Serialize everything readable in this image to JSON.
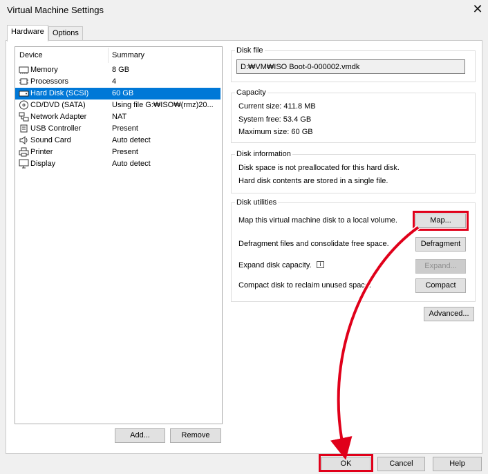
{
  "window": {
    "title": "Virtual Machine Settings",
    "close_glyph": "✕"
  },
  "tabs": [
    {
      "label": "Hardware",
      "active": true
    },
    {
      "label": "Options",
      "active": false
    }
  ],
  "device_list": {
    "col_device": "Device",
    "col_summary": "Summary",
    "rows": [
      {
        "device": "Memory",
        "summary": "8 GB",
        "icon": "memory-icon"
      },
      {
        "device": "Processors",
        "summary": "4",
        "icon": "processor-icon"
      },
      {
        "device": "Hard Disk (SCSI)",
        "summary": "60 GB",
        "icon": "hard-disk-icon",
        "selected": true
      },
      {
        "device": "CD/DVD (SATA)",
        "summary": "Using file G:₩ISO₩(rmz)20...",
        "icon": "cd-dvd-icon"
      },
      {
        "device": "Network Adapter",
        "summary": "NAT",
        "icon": "network-adapter-icon"
      },
      {
        "device": "USB Controller",
        "summary": "Present",
        "icon": "usb-controller-icon"
      },
      {
        "device": "Sound Card",
        "summary": "Auto detect",
        "icon": "sound-card-icon"
      },
      {
        "device": "Printer",
        "summary": "Present",
        "icon": "printer-icon"
      },
      {
        "device": "Display",
        "summary": "Auto detect",
        "icon": "display-icon"
      }
    ],
    "add_label": "Add...",
    "remove_label": "Remove"
  },
  "disk_file": {
    "label": "Disk file",
    "value": "D:₩VM₩ISO Boot-0-000002.vmdk"
  },
  "capacity": {
    "label": "Capacity",
    "current_size": "Current size:  411.8 MB",
    "system_free": "System free:  53.4 GB",
    "maximum_size": "Maximum size:  60 GB"
  },
  "disk_information": {
    "label": "Disk information",
    "line1": "Disk space is not preallocated for this hard disk.",
    "line2": "Hard disk contents are stored in a single file."
  },
  "disk_utilities": {
    "label": "Disk utilities",
    "map_text": "Map this virtual machine disk to a local volume.",
    "map_button": "Map...",
    "defrag_text": "Defragment files and consolidate free space.",
    "defrag_button": "Defragment",
    "expand_text": "Expand disk capacity.",
    "expand_button": "Expand...",
    "compact_text": "Compact disk to reclaim unused space.",
    "compact_button": "Compact"
  },
  "advanced_button": "Advanced...",
  "footer": {
    "ok": "OK",
    "cancel": "Cancel",
    "help": "Help"
  },
  "colors": {
    "selection": "#0078d7",
    "highlight": "#e0001a"
  }
}
